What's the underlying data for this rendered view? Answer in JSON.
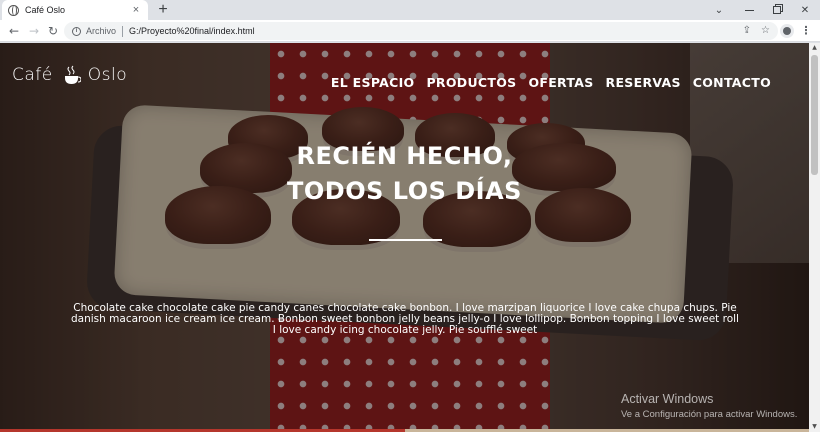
{
  "browser": {
    "tab_title": "Café Oslo",
    "tab_close": "×",
    "new_tab": "+",
    "address_scheme": "Archivo",
    "address_url": "G:/Proyecto%20final/index.html",
    "icons": [
      "info-icon",
      "share-icon",
      "bookmark-star-icon",
      "profile-icon",
      "kebab-menu-icon"
    ]
  },
  "site": {
    "logo_text_left": "Café",
    "logo_text_right": "Oslo",
    "nav": [
      "EL ESPACIO",
      "PRODUCTOS",
      "OFERTAS",
      "RESERVAS",
      "CONTACTO"
    ],
    "headline_line1": "RECIÉN HECHO,",
    "headline_line2": "TODOS LOS DÍAS",
    "lead": "Chocolate cake chocolate cake pie candy canes chocolate cake bonbon. I love marzipan liquorice I love cake chupa chups. Pie danish macaroon ice cream ice cream. Bonbon sweet bonbon jelly beans jelly-o I love lollipop. Bonbon topping I love sweet roll I love candy icing chocolate jelly. Pie soufflé sweet"
  },
  "watermark": {
    "title": "Activar Windows",
    "subtitle": "Ve a Configuración para activar Windows."
  },
  "colors": {
    "accent_red": "#b5362c",
    "hero_text": "#ffffff"
  }
}
